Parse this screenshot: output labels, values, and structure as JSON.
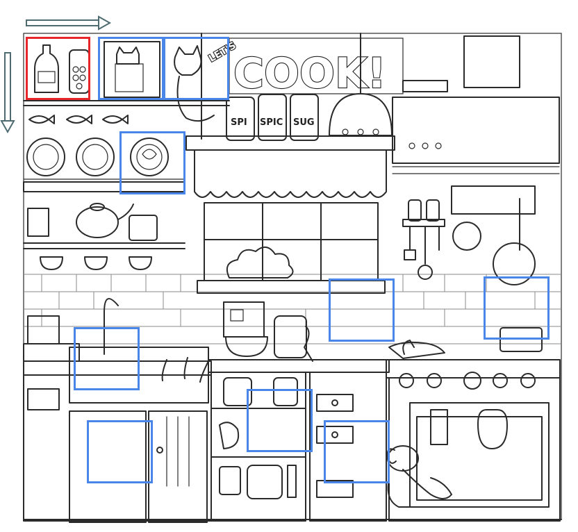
{
  "game": {
    "type": "hidden-object",
    "target_icon": "cat-icon"
  },
  "scene_text": {
    "sign_lets": "LET'S",
    "sign_cook": "COOK!",
    "jar_left": "SPI",
    "jar_middle": "SPIC",
    "jar_right": "SUG"
  },
  "scan_arrows": {
    "horizontal_icon": "arrow-right-icon",
    "vertical_icon": "arrow-down-icon",
    "color": "#6a8a8e"
  },
  "colors": {
    "found_box": "#4a86e8",
    "selected_box": "#e5262b",
    "line_art": "#2a2a2a"
  },
  "boxes": [
    {
      "id": 1,
      "state": "selected",
      "label": "bottle shelf"
    },
    {
      "id": 2,
      "state": "found",
      "label": "cat in cabinet"
    },
    {
      "id": 3,
      "state": "found",
      "label": "cat on pole"
    },
    {
      "id": 4,
      "state": "found",
      "label": "cat plate"
    },
    {
      "id": 5,
      "state": "found",
      "label": "cat by stove"
    },
    {
      "id": 6,
      "state": "found",
      "label": "cat in pan"
    },
    {
      "id": 7,
      "state": "found",
      "label": "cat in sink"
    },
    {
      "id": 8,
      "state": "found",
      "label": "cat on shelf"
    },
    {
      "id": 9,
      "state": "found",
      "label": "cat in drawer"
    },
    {
      "id": 10,
      "state": "found",
      "label": "cat under sink"
    }
  ]
}
